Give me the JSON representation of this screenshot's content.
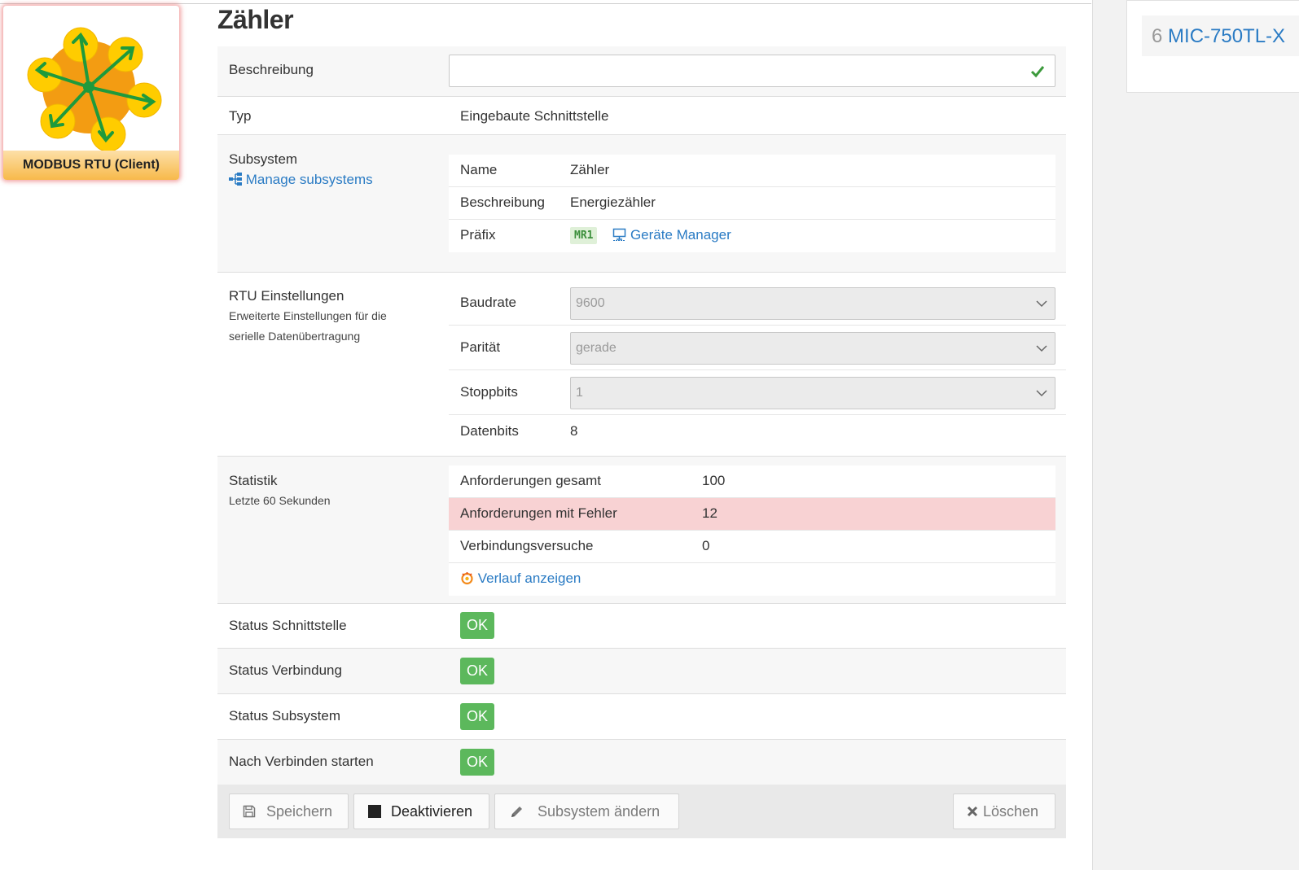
{
  "logo": {
    "caption": "MODBUS RTU (Client)"
  },
  "page": {
    "title": "Zähler"
  },
  "rows": {
    "beschreibung": {
      "label": "Beschreibung",
      "value": ""
    },
    "typ": {
      "label": "Typ",
      "value": "Eingebaute Schnittstelle"
    },
    "subsystem": {
      "label": "Subsystem",
      "manage_link": "Manage subsystems",
      "name_label": "Name",
      "name_value": "Zähler",
      "desc_label": "Beschreibung",
      "desc_value": "Energiezähler",
      "prefix_label": "Präfix",
      "prefix_badge": "MR1",
      "device_manager_link": "Geräte Manager"
    },
    "rtu": {
      "label": "RTU Einstellungen",
      "desc_line1": "Erweiterte Einstellungen für die",
      "desc_line2": "serielle Datenübertragung",
      "baud_label": "Baudrate",
      "baud_value": "9600",
      "parity_label": "Parität",
      "parity_value": "gerade",
      "stop_label": "Stoppbits",
      "stop_value": "1",
      "data_label": "Datenbits",
      "data_value": "8"
    },
    "stat": {
      "label": "Statistik",
      "desc": "Letzte 60 Sekunden",
      "total_label": "Anforderungen gesamt",
      "total_value": "100",
      "errors_label": "Anforderungen mit Fehler",
      "errors_value": "12",
      "attempts_label": "Verbindungsversuche",
      "attempts_value": "0",
      "history_link": "Verlauf anzeigen"
    },
    "status_interface": {
      "label": "Status Schnittstelle",
      "badge": "OK"
    },
    "status_connection": {
      "label": "Status Verbindung",
      "badge": "OK"
    },
    "status_subsystem": {
      "label": "Status Subsystem",
      "badge": "OK"
    },
    "start_after_connect": {
      "label": "Nach Verbinden starten",
      "badge": "OK"
    }
  },
  "toolbar": {
    "save": "Speichern",
    "deactivate": "Deaktivieren",
    "change_subsystem": "Subsystem ändern",
    "delete": "Löschen"
  },
  "right_panel": {
    "item_number": "6",
    "item_link": "MIC-750TL-X"
  },
  "colors": {
    "link": "#2a7bc4",
    "ok": "#5cb85c",
    "danger_row": "#f8d2d3",
    "prefix_badge_bg": "#dff0d8",
    "logo_orange": "#f39c12",
    "logo_yellow": "#ffcc00"
  },
  "icons": [
    "sitemap-icon",
    "check-icon",
    "monitor-icon",
    "grafana-icon",
    "save-icon",
    "stop-icon",
    "pencil-icon",
    "close-icon",
    "chevron-down-icon",
    "modbus-logo-icon"
  ]
}
